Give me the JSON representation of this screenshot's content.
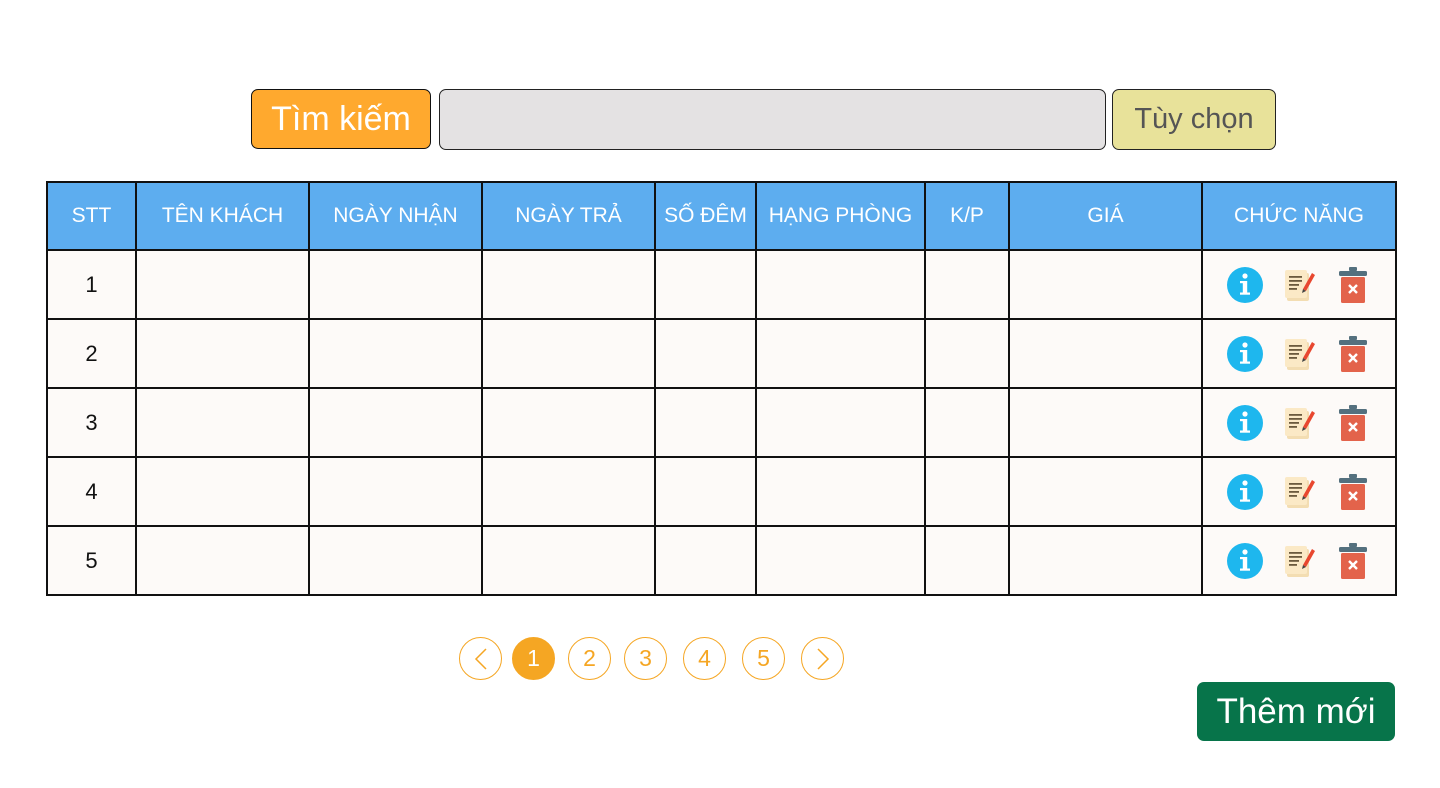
{
  "search": {
    "button_label": "Tìm kiếm",
    "value": "",
    "placeholder": ""
  },
  "options_button_label": "Tùy chọn",
  "table": {
    "headers": [
      "STT",
      "TÊN KHÁCH",
      "NGÀY NHẬN",
      "NGÀY TRẢ",
      "SỐ ĐÊM",
      "HẠNG PHÒNG",
      "K/P",
      "GIÁ",
      "CHỨC NĂNG"
    ],
    "rows": [
      {
        "stt": "1"
      },
      {
        "stt": "2"
      },
      {
        "stt": "3"
      },
      {
        "stt": "4"
      },
      {
        "stt": "5"
      }
    ],
    "row_actions": [
      "info-icon",
      "edit-icon",
      "delete-icon"
    ]
  },
  "pagination": {
    "prev": "<",
    "pages": [
      "1",
      "2",
      "3",
      "4",
      "5"
    ],
    "current": "1",
    "next": ">"
  },
  "add_button_label": "Thêm mới",
  "colors": {
    "header_bg": "#5DADEF",
    "search_button": "#FFA92E",
    "options_button": "#E8E29A",
    "pagination_accent": "#F5A623",
    "add_button": "#07744A"
  }
}
